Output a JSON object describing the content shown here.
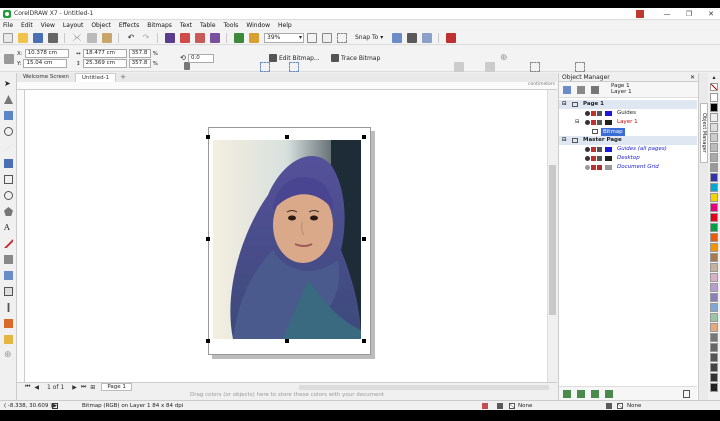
{
  "window": {
    "title": "CorelDRAW X7 - Untitled-1",
    "minimize": "—",
    "restore": "❐",
    "close": "✕"
  },
  "menu": [
    "File",
    "Edit",
    "View",
    "Layout",
    "Object",
    "Effects",
    "Bitmaps",
    "Text",
    "Table",
    "Tools",
    "Window",
    "Help"
  ],
  "toolbar": {
    "zoom_value": "39%",
    "snap_to": "Snap To",
    "snap_arrow": "▾"
  },
  "propertybar": {
    "x_label": "X:",
    "x_value": "10.378 cm",
    "y_label": "Y:",
    "y_value": "15.04 cm",
    "w_icon": "↔",
    "width": "18.477 cm",
    "h_icon": "↕",
    "height": "25.369 cm",
    "scale_w": "357.8",
    "scale_h": "357.8",
    "percent": "%",
    "rotation": "0.0",
    "edit_bitmap": "Edit Bitmap...",
    "trace_bitmap": "Trace Bitmap"
  },
  "doc_tabs": {
    "welcome": "Welcome Screen",
    "document": "Untitled-1",
    "add": "+"
  },
  "ruler": {
    "unit": "centimeters"
  },
  "pagebar": {
    "page_count": "1 of 1",
    "page_tab": "Page 1"
  },
  "palette_hint": "Drag colors (or objects) here to store these colors with your document",
  "object_manager": {
    "title": "Object Manager",
    "close": "✕",
    "current_page": "Page 1",
    "current_layer": "Layer 1",
    "rows": [
      {
        "label": "Page 1",
        "kind": "header"
      },
      {
        "label": "Guides",
        "kind": "layer",
        "swatch": "#1a1ad8"
      },
      {
        "label": "Layer 1",
        "kind": "layer-active",
        "swatch": "#222222"
      },
      {
        "label": "Bitmap",
        "kind": "object"
      },
      {
        "label": "Master Page",
        "kind": "header"
      },
      {
        "label": "Guides (all pages)",
        "kind": "master",
        "swatch": "#1a1ad8"
      },
      {
        "label": "Desktop",
        "kind": "master",
        "swatch": "#222222"
      },
      {
        "label": "Document Grid",
        "kind": "master",
        "swatch": "#999999"
      }
    ]
  },
  "docker_tab_label": "Object Manager",
  "status": {
    "coords": "( -8.338, 30.609 )",
    "info": "Bitmap (RGB) on Layer 1 84 x 84 dpi",
    "fill_none": "None",
    "outline_none": "None"
  },
  "palette_colors": [
    "#ffffff",
    "#000000",
    "#eeeeee",
    "#dddddd",
    "#cccccc",
    "#bbbbbb",
    "#aaaaaa",
    "#999999",
    "#3333aa",
    "#00a6d6",
    "#f4d400",
    "#e8007d",
    "#e2001a",
    "#00a044",
    "#ea5b0c",
    "#f39200",
    "#a67c52",
    "#c2b39a",
    "#d8b0c8",
    "#b79dd0",
    "#8e7fb8",
    "#7fa8d8",
    "#9bc6a5",
    "#e6a97a",
    "#777777",
    "#666666",
    "#555555",
    "#444444",
    "#333333",
    "#222222"
  ],
  "colors": {
    "accent_blue": "#1a1ad8",
    "selection_highlight": "#3a6cd6",
    "active_layer_red": "#cc0000"
  }
}
